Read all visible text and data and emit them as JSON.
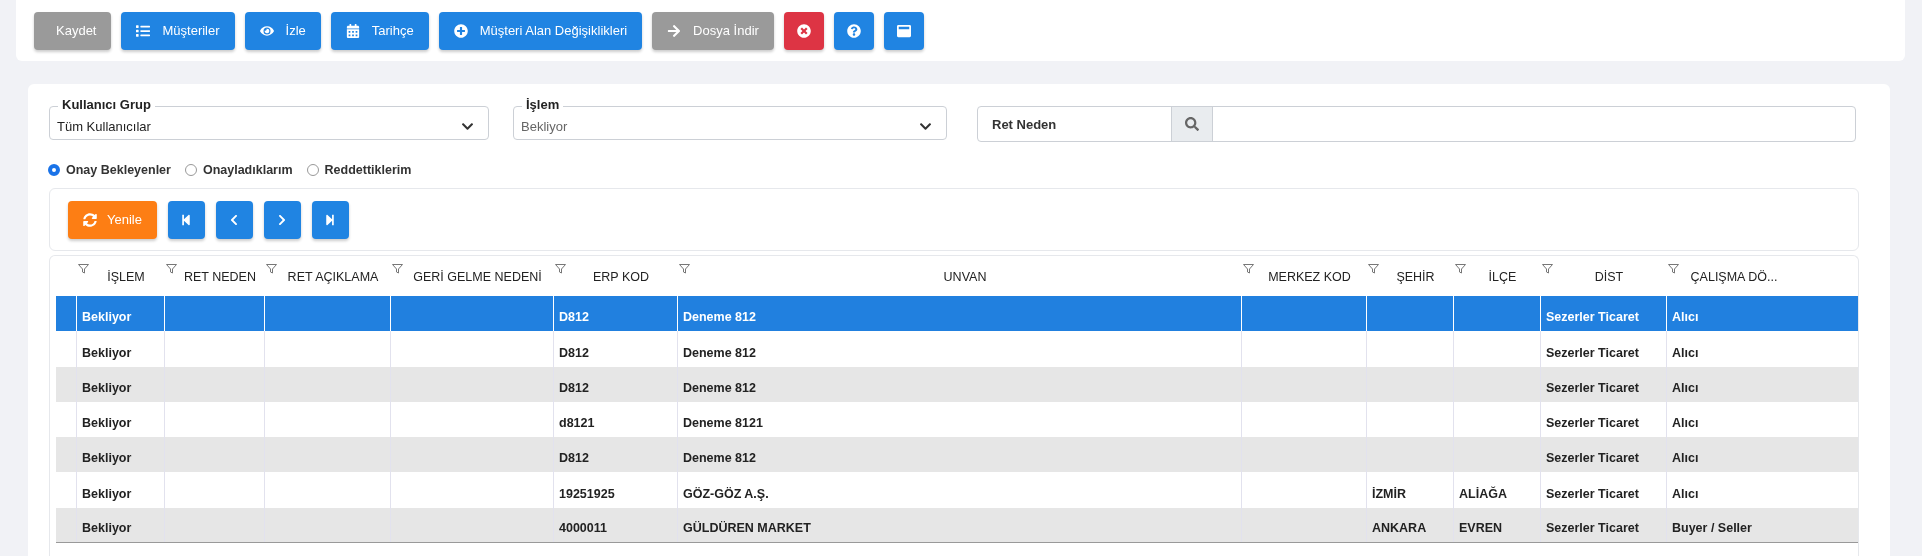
{
  "toolbar": [
    {
      "label": "Kaydet",
      "kind": "secondary"
    },
    {
      "label": "Müşteriler",
      "kind": "primary"
    },
    {
      "label": "İzle",
      "kind": "primary"
    },
    {
      "label": "Tarihçe",
      "kind": "primary"
    },
    {
      "label": "Müşteri Alan Değişiklikleri",
      "kind": "primary"
    },
    {
      "label": "Dosya İndir",
      "kind": "secondary"
    },
    {
      "kind": "danger"
    },
    {
      "kind": "primary"
    },
    {
      "kind": "primary"
    }
  ],
  "filters": {
    "user_group": {
      "label": "Kullanıcı Grup",
      "value": "Tüm Kullanıcılar"
    },
    "operation": {
      "label": "İşlem",
      "value": "Bekliyor"
    },
    "search": {
      "label": "Ret Neden"
    }
  },
  "radios": [
    {
      "label": "Onay Bekleyenler",
      "selected": true
    },
    {
      "label": "Onayladıklarım",
      "selected": false
    },
    {
      "label": "Reddettiklerim",
      "selected": false
    }
  ],
  "grid_toolbar": {
    "refresh": "Yenile",
    "pager": [
      {
        "kind": "first"
      },
      {
        "kind": "prev"
      },
      {
        "kind": "next"
      },
      {
        "kind": "last"
      }
    ]
  },
  "table": {
    "columns": [
      "İŞLEM",
      "RET NEDEN",
      "RET AÇIKLAMA",
      "GERİ GELME NEDENİ",
      "ERP KOD",
      "UNVAN",
      "MERKEZ KOD",
      "ŞEHİR",
      "İLÇE",
      "DİST",
      "ÇALIŞMA DÖ..."
    ],
    "rows": [
      {
        "selected": true,
        "cells": [
          "Bekliyor",
          "",
          "",
          "",
          "D812",
          "Deneme 812",
          "",
          "",
          "",
          "Sezerler Ticaret",
          "Alıcı"
        ]
      },
      {
        "selected": false,
        "cells": [
          "Bekliyor",
          "",
          "",
          "",
          "D812",
          "Deneme 812",
          "",
          "",
          "",
          "Sezerler Ticaret",
          "Alıcı"
        ]
      },
      {
        "selected": false,
        "cells": [
          "Bekliyor",
          "",
          "",
          "",
          "D812",
          "Deneme 812",
          "",
          "",
          "",
          "Sezerler Ticaret",
          "Alıcı"
        ]
      },
      {
        "selected": false,
        "cells": [
          "Bekliyor",
          "",
          "",
          "",
          "d8121",
          "Deneme 8121",
          "",
          "",
          "",
          "Sezerler Ticaret",
          "Alıcı"
        ]
      },
      {
        "selected": false,
        "cells": [
          "Bekliyor",
          "",
          "",
          "",
          "D812",
          "Deneme 812",
          "",
          "",
          "",
          "Sezerler Ticaret",
          "Alıcı"
        ]
      },
      {
        "selected": false,
        "cells": [
          "Bekliyor",
          "",
          "",
          "",
          "19251925",
          "GÖZ-GÖZ A.Ş.",
          "",
          "İZMİR",
          "ALİAĞA",
          "Sezerler Ticaret",
          "Alıcı"
        ]
      },
      {
        "selected": false,
        "cells": [
          "Bekliyor",
          "",
          "",
          "",
          "4000011",
          "GÜLDÜREN MARKET",
          "",
          "ANKARA",
          "EVREN",
          "Sezerler Ticaret",
          "Buyer / Seller"
        ]
      }
    ]
  }
}
